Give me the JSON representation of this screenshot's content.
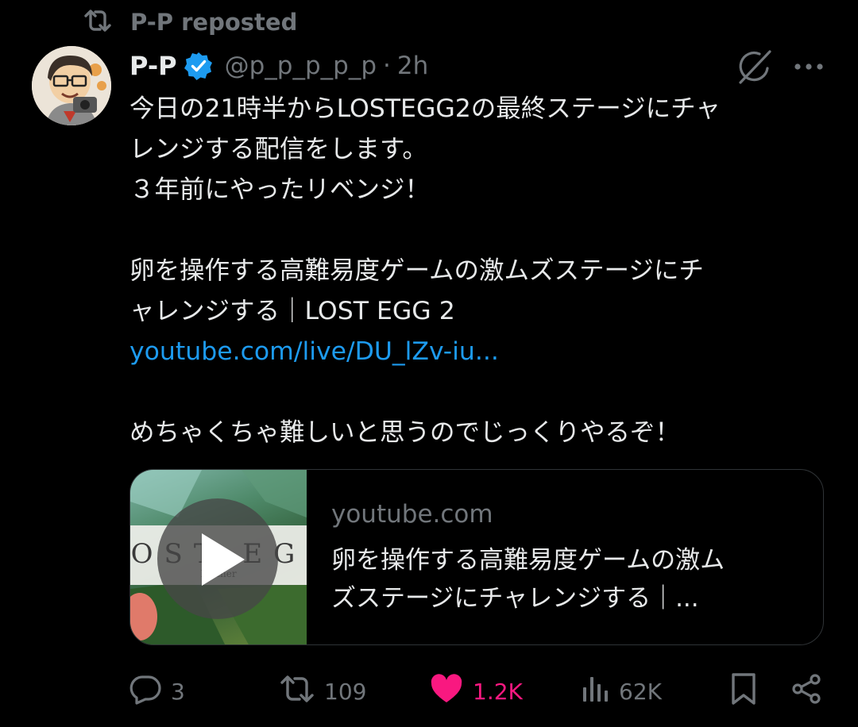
{
  "repost_header": {
    "label": "P-P reposted",
    "icon": "repost-icon"
  },
  "author": {
    "name": "P-P",
    "verified": true,
    "handle": "@p_p_p_p_p",
    "separator": "·",
    "time": "2h"
  },
  "header_actions": [
    {
      "icon": "grok-icon"
    },
    {
      "icon": "more-icon"
    }
  ],
  "tweet": {
    "line1": "今日の21時半からLOSTEGG2の最終ステージにチャ",
    "line2": "レンジする配信をします。",
    "line3": "３年前にやったリベンジ！",
    "line4": "卵を操作する高難易度ゲームの激ムズステージにチ",
    "line5": "ャレンジする｜LOST EGG 2",
    "link": "youtube.com/live/DU_lZv-iu...",
    "line6": "めちゃくちゃ難しいと思うのでじっくりやるぞ！"
  },
  "card": {
    "domain": "youtube.com",
    "title_line1": "卵を操作する高難易度ゲームの激ム",
    "title_line2": "ズステージにチャレンジする｜...",
    "thumbnail_logo": "OST EG",
    "thumbnail_sub": "Be   ther"
  },
  "actions": {
    "reply_count": "3",
    "repost_count": "109",
    "like_count": "1.2K",
    "view_count": "62K"
  },
  "colors": {
    "background": "#000000",
    "text": "#e7e9ea",
    "muted": "#71767b",
    "link": "#1d9bf0",
    "like": "#f91880",
    "verified": "#1d9bf0"
  }
}
